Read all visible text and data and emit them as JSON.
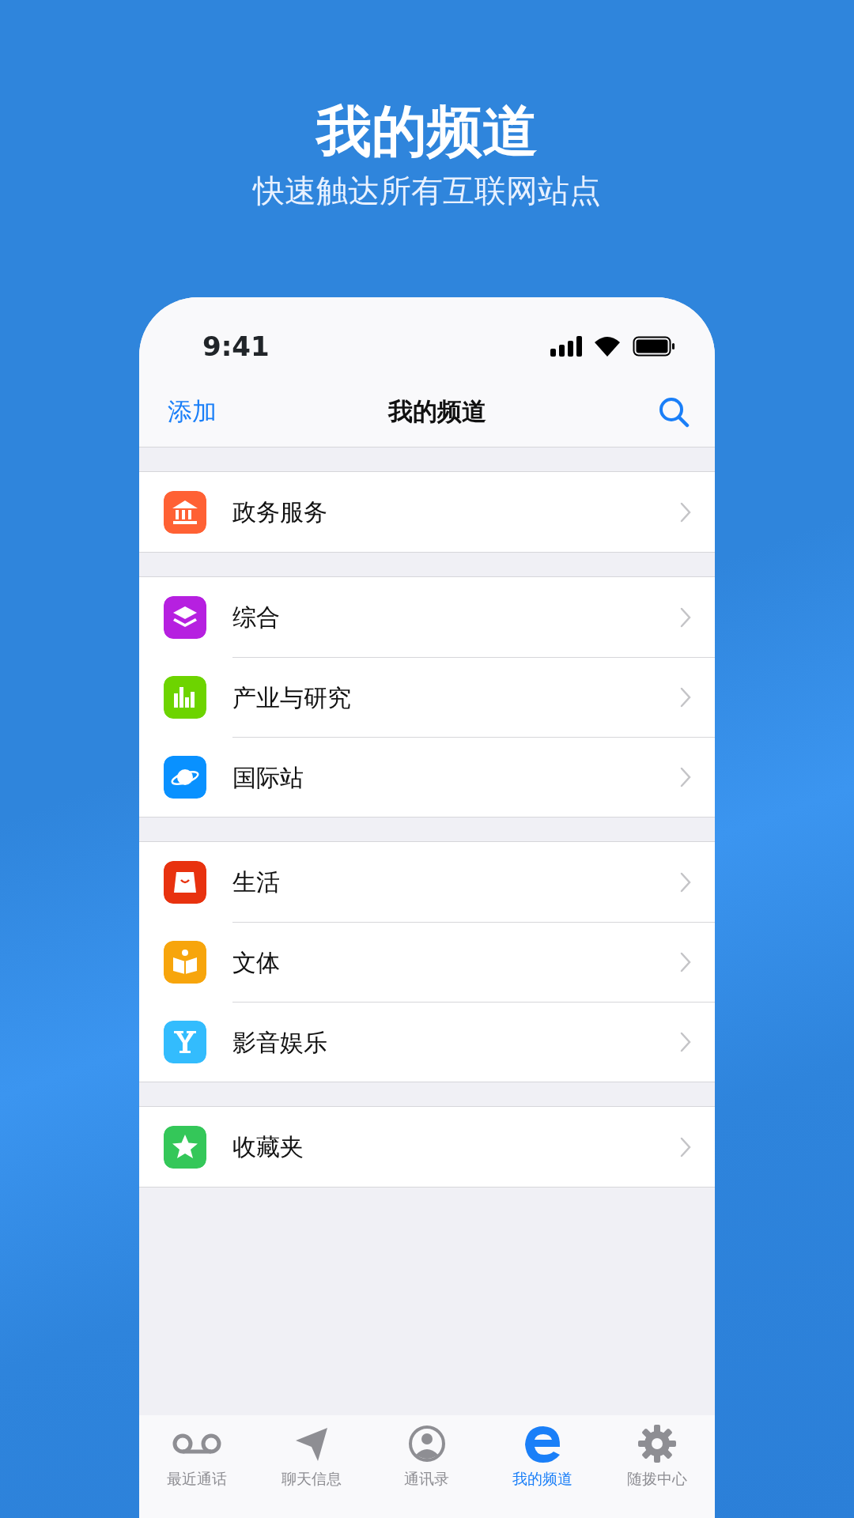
{
  "promo": {
    "title": "我的频道",
    "subtitle": "快速触达所有互联网站点"
  },
  "status_bar": {
    "time": "9:41"
  },
  "nav_bar": {
    "left_action": "添加",
    "title": "我的频道"
  },
  "groups": [
    {
      "items": [
        {
          "label": "政务服务",
          "kind": "bank",
          "color": "#ff6134"
        }
      ]
    },
    {
      "items": [
        {
          "label": "综合",
          "kind": "layers",
          "color": "#b620e0"
        },
        {
          "label": "产业与研究",
          "kind": "bars",
          "color": "#6dd400"
        },
        {
          "label": "国际站",
          "kind": "planet",
          "color": "#0991ff"
        }
      ]
    },
    {
      "items": [
        {
          "label": "生活",
          "kind": "bag",
          "color": "#e8320f"
        },
        {
          "label": "文体",
          "kind": "reader",
          "color": "#f7a50c"
        },
        {
          "label": "影音娱乐",
          "kind": "letter",
          "color": "#33bcfd"
        }
      ]
    },
    {
      "items": [
        {
          "label": "收藏夹",
          "kind": "star",
          "color": "#34c759"
        }
      ]
    }
  ],
  "tabs": [
    {
      "label": "最近通话",
      "kind": "voicemail",
      "selected": false
    },
    {
      "label": "聊天信息",
      "kind": "send",
      "selected": false
    },
    {
      "label": "通讯录",
      "kind": "contact",
      "selected": false
    },
    {
      "label": "我的频道",
      "kind": "browser",
      "selected": true
    },
    {
      "label": "随拨中心",
      "kind": "gear",
      "selected": false
    }
  ]
}
